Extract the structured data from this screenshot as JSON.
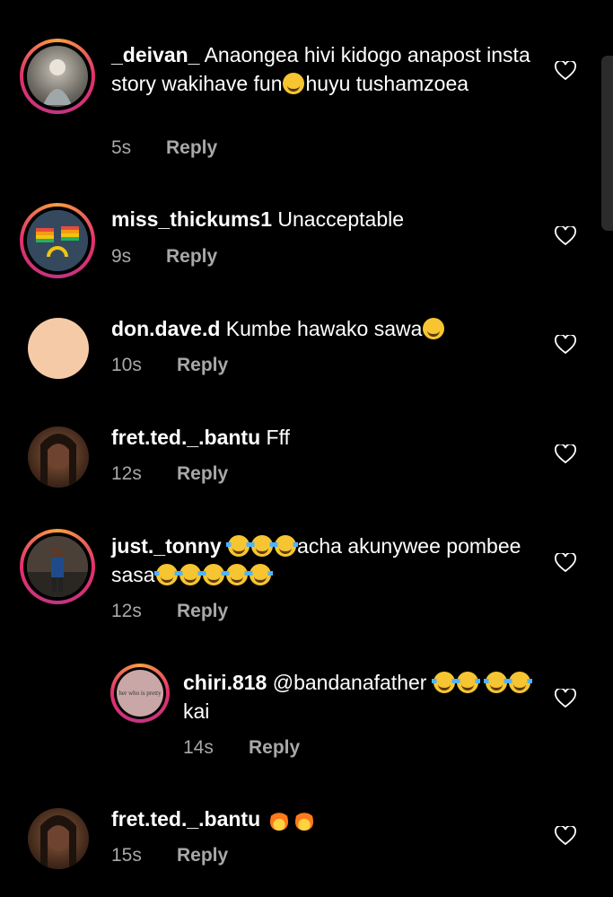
{
  "comments": [
    {
      "username": "_deivan_",
      "text": "Anaongea hivi kidogo anapost insta story wakihave fun",
      "text_after": "huyu tushamzoea",
      "time": "5s",
      "reply": "Reply"
    },
    {
      "username": "miss_thickums1",
      "text": "Unacceptable",
      "time": "9s",
      "reply": "Reply"
    },
    {
      "username": "don.dave.d",
      "text": "Kumbe hawako sawa",
      "time": "10s",
      "reply": "Reply"
    },
    {
      "username": "fret.ted._.bantu",
      "text": "Fff",
      "time": "12s",
      "reply": "Reply"
    },
    {
      "username": "just._tonny",
      "text": "acha akunywee pombee sasa",
      "time": "12s",
      "reply": "Reply"
    },
    {
      "username": "chiri.818",
      "text": "@bandanafather",
      "text_after": "kai",
      "avatar_text": "her who is pretty",
      "time": "14s",
      "reply": "Reply"
    },
    {
      "username": "fret.ted._.bantu",
      "text": "",
      "time": "15s",
      "reply": "Reply"
    }
  ],
  "icons": {
    "like": "heart-outline-icon",
    "emoji_roll": "face-rolling-eyes",
    "emoji_laugh": "face-tears-of-joy",
    "emoji_sweat": "grinning-face-sweat",
    "emoji_cry": "crying-face",
    "emoji_fire": "fire"
  },
  "colors": {
    "background": "#000000",
    "text": "#ffffff",
    "secondary": "#a8a8a8",
    "story_ring": "#e1306c"
  }
}
